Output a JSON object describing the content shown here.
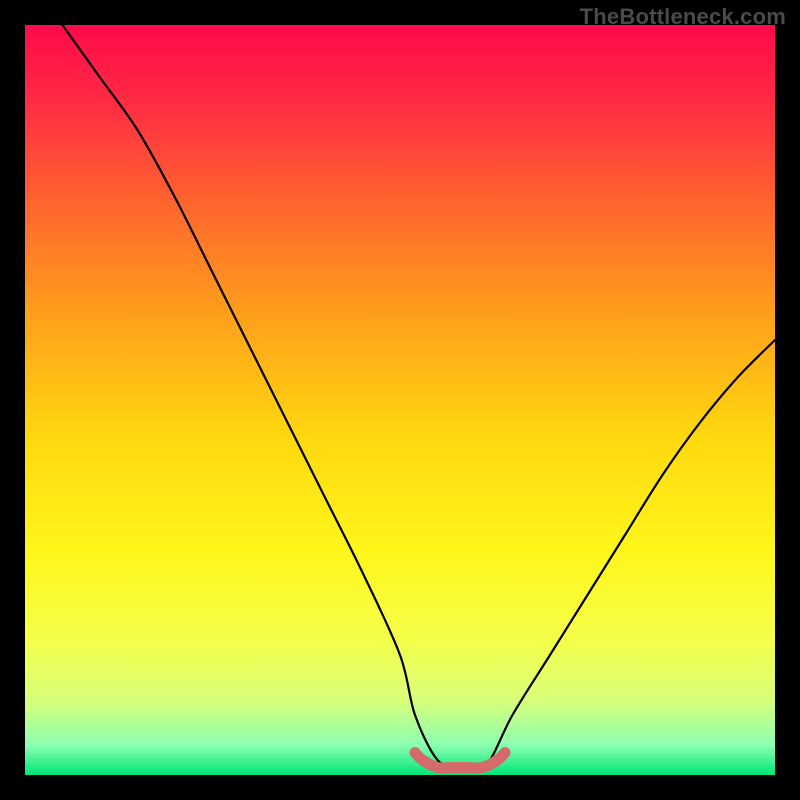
{
  "watermark": "TheBottleneck.com",
  "chart_data": {
    "type": "line",
    "title": "",
    "xlabel": "",
    "ylabel": "",
    "xlim": [
      0,
      100
    ],
    "ylim": [
      0,
      100
    ],
    "series": [
      {
        "name": "bottleneck-curve",
        "x": [
          5,
          10,
          15,
          20,
          25,
          30,
          35,
          40,
          45,
          50,
          52,
          55,
          58,
          60,
          62,
          65,
          70,
          75,
          80,
          85,
          90,
          95,
          100
        ],
        "values": [
          100,
          93,
          86,
          77,
          67,
          57,
          47,
          37,
          27,
          16,
          8,
          2,
          1,
          1,
          2,
          8,
          16,
          24,
          32,
          40,
          47,
          53,
          58
        ]
      },
      {
        "name": "highlight-band",
        "x": [
          52,
          53,
          55,
          57,
          59,
          61,
          63,
          64
        ],
        "values": [
          3,
          2,
          1,
          1,
          1,
          1,
          2,
          3
        ]
      }
    ],
    "gradient_stops": [
      {
        "offset": 0.0,
        "color": "#ff0a4a"
      },
      {
        "offset": 0.1,
        "color": "#ff2a44"
      },
      {
        "offset": 0.25,
        "color": "#ff6a2c"
      },
      {
        "offset": 0.4,
        "color": "#ffa41a"
      },
      {
        "offset": 0.55,
        "color": "#ffd80f"
      },
      {
        "offset": 0.7,
        "color": "#fff61a"
      },
      {
        "offset": 0.82,
        "color": "#f4ff4a"
      },
      {
        "offset": 0.9,
        "color": "#d8ff7a"
      },
      {
        "offset": 0.96,
        "color": "#8cffb0"
      },
      {
        "offset": 1.0,
        "color": "#00e676"
      }
    ],
    "colors": {
      "curve": "#000000",
      "highlight": "#d46a6a",
      "frame": "#000000"
    }
  }
}
